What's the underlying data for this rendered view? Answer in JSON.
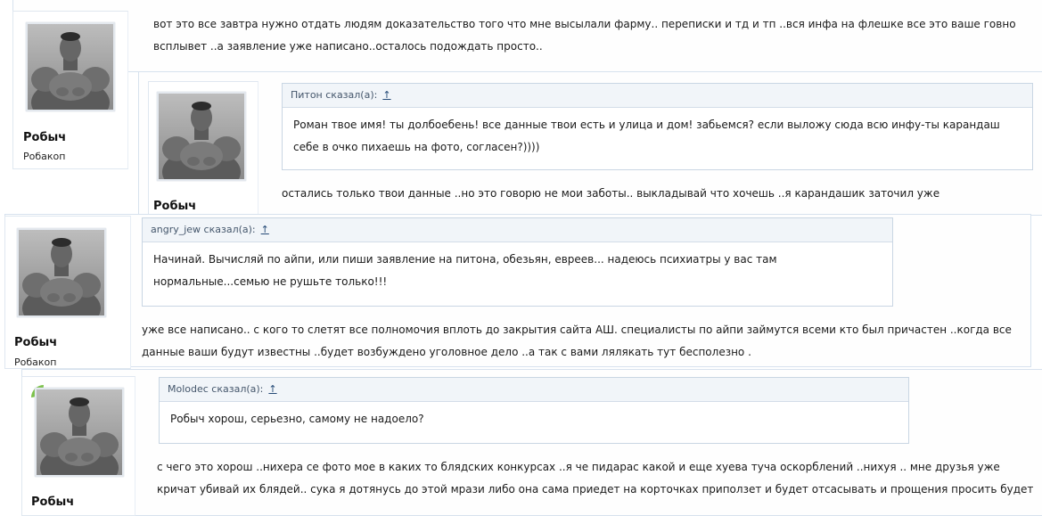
{
  "posts": [
    {
      "author": "Робыч",
      "user_title": "Робакоп",
      "text": "вот это все завтра нужно отдать людям доказательство того что мне высылали фарму.. переписки и тд и тп ..вся инфа на флешке все это ваше говно всплывет ..а заявление уже написано..осталось подождать просто.."
    },
    {
      "author": "Робыч",
      "quote_header": "Питон сказал(а):",
      "quote_link": "↑",
      "quote_text": "Роман твое имя! ты долбоебень! все данные твои есть и улица и дом! забьемся? если выложу сюда всю инфу-ты карандаш себе в очко пихаешь на фото, согласен?))))",
      "text": "остались только твои данные ..но это говорю не мои заботы.. выкладывай что хочешь ..я карандашик заточил уже"
    },
    {
      "author": "Робыч",
      "user_title": "Робакоп",
      "quote_header": "angry_jew сказал(а):",
      "quote_link": "↑",
      "quote_text": "Начинай. Вычисляй по айпи, или пиши заявление на питона, обезьян, евреев... надеюсь психиатры у вас там нормальные...семью не рушьте только!!!",
      "text": "уже все написано.. с кого то слетят все полномочия вплоть до закрытия сайта АШ. специалисты по айпи займутся всеми кто был причастен ..когда все данные ваши будут известны ..будет возбуждено уголовное дело ..а так с вами лялякать тут бесполезно ."
    },
    {
      "author": "Робыч",
      "quote_header": "Molodec сказал(а):",
      "quote_link": "↑",
      "quote_text": "Робыч хорош, серьезно, самому не надоело?",
      "text": "с чего это хорош ..нихера се фото мое в каких то блядских конкурсах ..я че пидарас какой и еще хуева туча оскорблений ..нихуя .. мне друзья уже кричат убивай их блядей.. сука я дотянусь до этой мрази либо она сама приедет на корточках приползет и будет отсасывать и прощения просить будет"
    }
  ],
  "colors": {
    "accent": "#254a76",
    "quote_bg": "#f1f5f9",
    "border": "#d7e2ee",
    "leaf": "#7cc24a"
  }
}
